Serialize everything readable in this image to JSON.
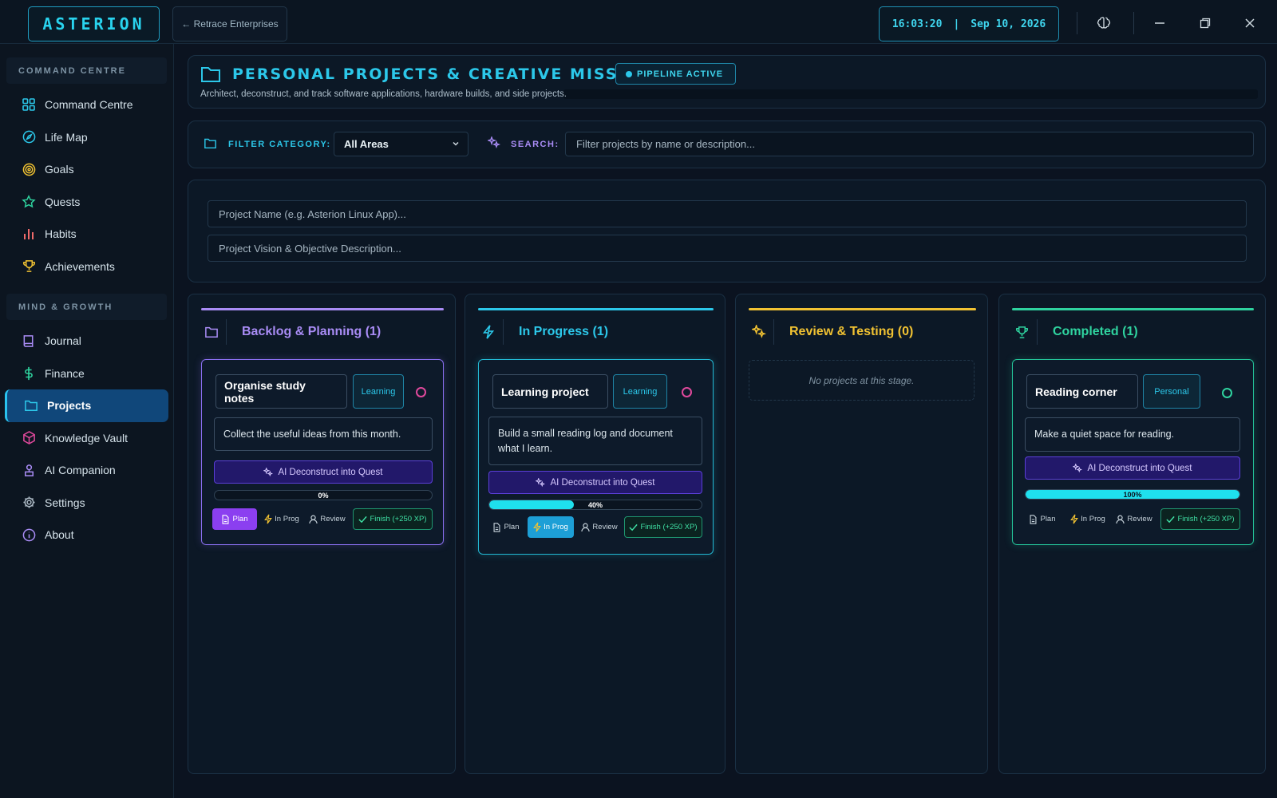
{
  "app": {
    "logo": "ASTERION",
    "back_label": "← Retrace Enterprises",
    "time": "16:03:20",
    "date": "Sep 10, 2026"
  },
  "sidebar": {
    "sections": [
      {
        "title": "COMMAND CENTRE",
        "items": [
          {
            "label": "Command Centre",
            "icon": "grid-icon",
            "color": "#2cc8ea"
          },
          {
            "label": "Life Map",
            "icon": "compass-icon",
            "color": "#2cc8ea"
          },
          {
            "label": "Goals",
            "icon": "target-icon",
            "color": "#f1c232"
          },
          {
            "label": "Quests",
            "icon": "star-icon",
            "color": "#2fd39f"
          },
          {
            "label": "Habits",
            "icon": "bar-chart-icon",
            "color": "#ef6a6a"
          },
          {
            "label": "Achievements",
            "icon": "trophy-icon",
            "color": "#f1c232"
          }
        ]
      },
      {
        "title": "MIND & GROWTH",
        "items": [
          {
            "label": "Journal",
            "icon": "book-icon",
            "color": "#a98cf5"
          },
          {
            "label": "Finance",
            "icon": "dollar-icon",
            "color": "#2fd39f"
          },
          {
            "label": "Projects",
            "icon": "folder-icon",
            "color": "#2cc8ea",
            "active": true
          },
          {
            "label": "Knowledge Vault",
            "icon": "cube-icon",
            "color": "#e0499c"
          },
          {
            "label": "AI Companion",
            "icon": "bot-icon",
            "color": "#a98cf5"
          },
          {
            "label": "Settings",
            "icon": "gear-icon",
            "color": "#aab7c2"
          },
          {
            "label": "About",
            "icon": "info-icon",
            "color": "#a98cf5"
          }
        ]
      }
    ]
  },
  "header": {
    "title": "PERSONAL PROJECTS & CREATIVE MISSIONS",
    "badge": "PIPELINE ACTIVE",
    "subtitle": "Architect, deconstruct, and track software applications, hardware builds, and side projects."
  },
  "filter": {
    "category_label": "FILTER CATEGORY:",
    "category_value": "All Areas",
    "search_label": "SEARCH:",
    "search_placeholder": "Filter projects by name or description..."
  },
  "new_project": {
    "name_placeholder": "Project Name (e.g. Asterion Linux App)...",
    "desc_placeholder": "Project Vision & Objective Description..."
  },
  "buttons": {
    "ai": "AI Deconstruct into Quest",
    "plan": "Plan",
    "in_prog": "In Prog",
    "review": "Review",
    "finish": "Finish (+250 XP)"
  },
  "columns": [
    {
      "title": "Backlog & Planning (1)",
      "color": "#a98cf5",
      "icon": "folder-icon",
      "cards": [
        {
          "title": "Organise study notes",
          "tag": "Learning",
          "description": "Collect the useful ideas from this month.",
          "progress": 0,
          "progress_label": "0%",
          "stage": "plan"
        }
      ]
    },
    {
      "title": "In Progress (1)",
      "color": "#2cc8ea",
      "icon": "lightning-icon",
      "cards": [
        {
          "title": "Learning project",
          "tag": "Learning",
          "description": "Build a small reading log and document what I learn.",
          "progress": 40,
          "progress_label": "40%",
          "stage": "in_prog"
        }
      ]
    },
    {
      "title": "Review & Testing (0)",
      "color": "#f1c232",
      "icon": "sparkle-icon",
      "empty_text": "No projects at this stage.",
      "cards": []
    },
    {
      "title": "Completed (1)",
      "color": "#2fd39f",
      "icon": "trophy-icon",
      "cards": [
        {
          "title": "Reading corner",
          "tag": "Personal",
          "description": "Make a quiet space for reading.",
          "progress": 100,
          "progress_label": "100%",
          "stage": "done"
        }
      ]
    }
  ]
}
